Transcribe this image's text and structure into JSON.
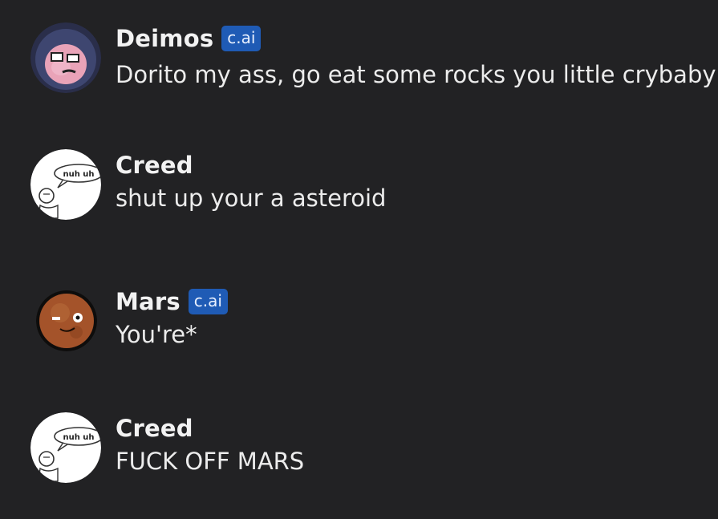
{
  "messages": [
    {
      "author": "Deimos",
      "badge": "c.ai",
      "text": "Dorito my ass, go eat some rocks you little crybaby",
      "avatar_icon": "deimos-avatar"
    },
    {
      "author": "Creed",
      "badge": "",
      "text": "shut up your a asteroid",
      "avatar_icon": "nuh-uh-meme-avatar",
      "avatar_caption": "nuh uh"
    },
    {
      "author": "Mars",
      "badge": "c.ai",
      "text": "You're*",
      "avatar_icon": "mars-planet-avatar"
    },
    {
      "author": "Creed",
      "badge": "",
      "text": "FUCK OFF MARS",
      "avatar_icon": "nuh-uh-meme-avatar",
      "avatar_caption": "nuh uh"
    }
  ],
  "colors": {
    "background": "#222224",
    "badge": "#1f5bb5",
    "text": "#ececec"
  }
}
